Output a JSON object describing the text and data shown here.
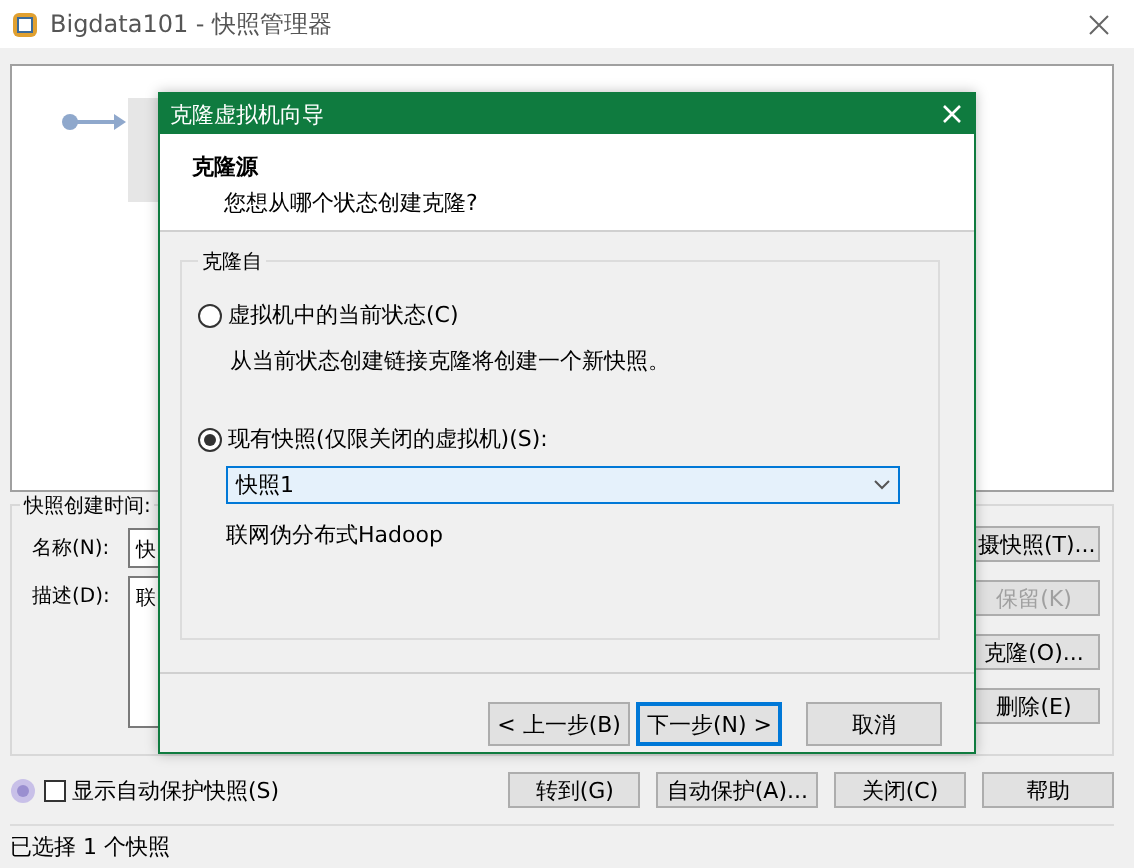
{
  "window": {
    "title": "Bigdata101 - 快照管理器"
  },
  "details": {
    "created_label": "快照创建时间:",
    "name_label": "名称(N):",
    "name_value": "快",
    "description_label": "描述(D):",
    "description_value": "联"
  },
  "side_buttons": [
    {
      "label": "摄快照(T)...",
      "disabled": false
    },
    {
      "label": "保留(K)",
      "disabled": true
    },
    {
      "label": "克隆(O)...",
      "disabled": false
    },
    {
      "label": "删除(E)",
      "disabled": false
    }
  ],
  "show_autoprotect": {
    "label": "显示自动保护快照(S)",
    "checked": false
  },
  "bottom_buttons": [
    "转到(G)",
    "自动保护(A)...",
    "关闭(C)",
    "帮助"
  ],
  "status_bar": "已选择 1 个快照",
  "dialog": {
    "title": "克隆虚拟机向导",
    "heading": "克隆源",
    "subheading": "您想从哪个状态创建克隆?",
    "group_label": "克隆自",
    "options": [
      {
        "label": "虚拟机中的当前状态(C)",
        "description": "从当前状态创建链接克隆将创建一个新快照。",
        "selected": false
      },
      {
        "label": "现有快照(仅限关闭的虚拟机)(S):",
        "selected": true
      }
    ],
    "snapshot_select": "快照1",
    "snapshot_description": "联网伪分布式Hadoop",
    "buttons": [
      {
        "label": "< 上一步(B)",
        "focused": false
      },
      {
        "label": "下一步(N) >",
        "focused": true
      },
      {
        "label": "取消",
        "focused": false
      }
    ]
  }
}
